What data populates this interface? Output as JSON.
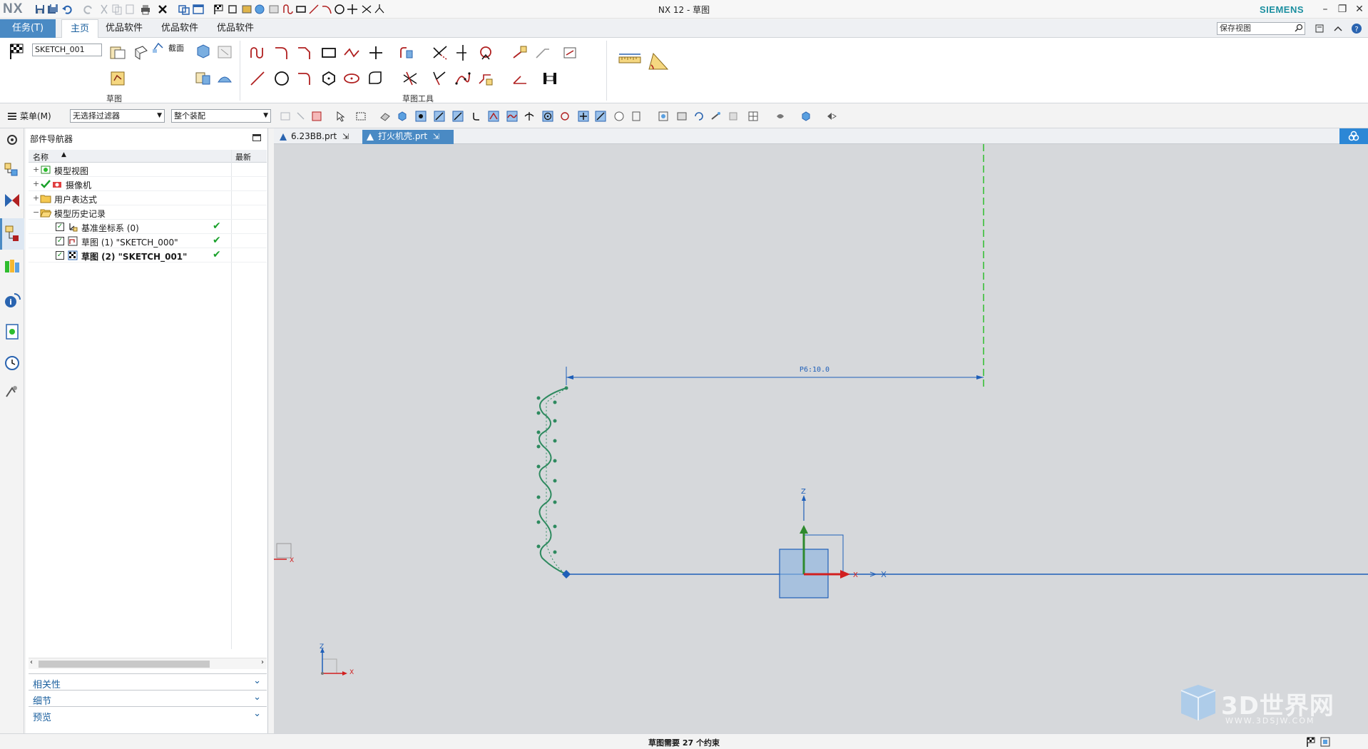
{
  "app": {
    "logo": "NX",
    "window_title": "NX 12 - 草图",
    "brand": "SIEMENS",
    "window_controls": {
      "minimize": "–",
      "restore": "❐",
      "close": "✕"
    }
  },
  "ribbon_tabs": {
    "task": "任务(T)",
    "items": [
      "主页",
      "优品软件",
      "优品软件",
      "优品软件"
    ],
    "search_placeholder": "保存视图"
  },
  "ribbon": {
    "sketch_name": "SKETCH_001",
    "section_label": "截面",
    "groups": [
      "草图",
      "草图工具"
    ]
  },
  "selection_bar": {
    "menu_label": "菜单(M)",
    "filter": "无选择过滤器",
    "scope": "整个装配"
  },
  "navigator": {
    "title": "部件导航器",
    "columns": [
      "名称",
      "最新"
    ],
    "rows": [
      {
        "label": "模型视图",
        "expander": "+"
      },
      {
        "label": "摄像机",
        "expander": "+"
      },
      {
        "label": "用户表达式",
        "expander": "+"
      },
      {
        "label": "模型历史记录",
        "expander": "−"
      },
      {
        "label": "基准坐标系 (0)",
        "latest": "✔"
      },
      {
        "label": "草图 (1) \"SKETCH_000\"",
        "latest": "✔"
      },
      {
        "label": "草图 (2) \"SKETCH_001\"",
        "latest": "✔"
      }
    ],
    "sections": [
      "相关性",
      "细节",
      "预览"
    ]
  },
  "doc_tabs": [
    {
      "label": "6.23BB.prt",
      "active": false
    },
    {
      "label": "打火机壳.prt",
      "active": true
    }
  ],
  "canvas": {
    "dimension_label": "P6:10.0",
    "axis_x": "X",
    "axis_z": "Z",
    "triad_x": "X",
    "triad_z": "Z"
  },
  "status": {
    "message": "草图需要 27 个约束"
  },
  "watermark": {
    "brand": "3D世界网",
    "url": "WWW.3DSJW.COM"
  },
  "colors": {
    "accent_blue": "#4a8ac4",
    "curve_green": "#2e8a5f",
    "axis_blue": "#1f5fb8",
    "axis_red": "#d21f1f",
    "axis_green": "#2e8a2e",
    "dashed_green": "#2ebd2e"
  }
}
